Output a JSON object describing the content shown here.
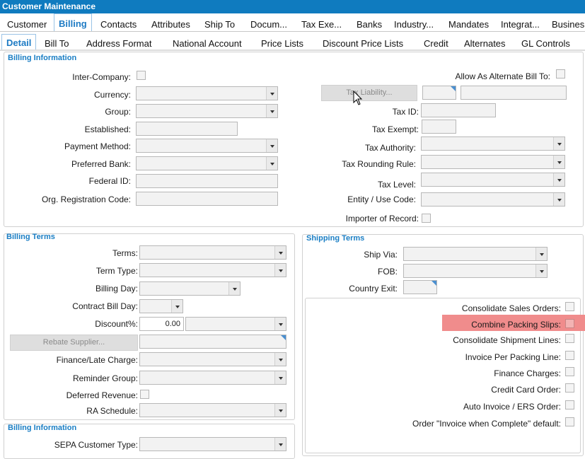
{
  "window": {
    "title": "Customer Maintenance"
  },
  "main_tabs": [
    "Customer",
    "Billing",
    "Contacts",
    "Attributes",
    "Ship To",
    "Docum...",
    "Tax Exe...",
    "Banks",
    "Industry...",
    "Mandates",
    "Integrat...",
    "Busines"
  ],
  "sub_tabs": [
    "Detail",
    "Bill To",
    "Address Format",
    "National Account",
    "Price Lists",
    "Discount Price Lists",
    "Credit",
    "Alternates",
    "GL Controls"
  ],
  "billing_info": {
    "title": "Billing Information",
    "inter_company": "Inter-Company:",
    "currency": "Currency:",
    "group": "Group:",
    "established": "Established:",
    "payment_method": "Payment Method:",
    "preferred_bank": "Preferred Bank:",
    "federal_id": "Federal ID:",
    "org_reg_code": "Org. Registration Code:",
    "allow_alt_bill_to": "Allow As Alternate Bill To:",
    "tax_liability_button": "Tax Liability...",
    "tax_id": "Tax ID:",
    "tax_exempt": "Tax Exempt:",
    "tax_authority": "Tax Authority:",
    "tax_rounding_rule": "Tax Rounding Rule:",
    "tax_level": "Tax Level:",
    "entity_use_code": "Entity / Use Code:",
    "importer_of_record": "Importer of Record:"
  },
  "billing_terms": {
    "title": "Billing Terms",
    "terms": "Terms:",
    "term_type": "Term Type:",
    "billing_day": "Billing Day:",
    "contract_bill_day": "Contract Bill Day:",
    "discount": "Discount%:",
    "discount_value": "0.00",
    "rebate_supplier_button": "Rebate Supplier...",
    "finance_late_charge": "Finance/Late Charge:",
    "reminder_group": "Reminder Group:",
    "deferred_revenue": "Deferred Revenue:",
    "ra_schedule": "RA Schedule:"
  },
  "shipping_terms": {
    "title": "Shipping Terms",
    "ship_via": "Ship Via:",
    "fob": "FOB:",
    "country_exit": "Country Exit:"
  },
  "options": {
    "consolidate_sales_orders": "Consolidate Sales Orders:",
    "combine_packing_slips": "Combine Packing Slips:",
    "consolidate_shipment_lines": "Consolidate Shipment Lines:",
    "invoice_per_packing_line": "Invoice Per Packing Line:",
    "finance_charges": "Finance Charges:",
    "credit_card_order": "Credit Card Order:",
    "auto_invoice_ers_order": "Auto Invoice / ERS Order:",
    "order_invoice_when_complete": "Order \"Invoice when Complete\" default:",
    "highlight_color": "#f08c8c"
  },
  "billing_info_2": {
    "title": "Billing Information",
    "sepa_customer_type": "SEPA Customer Type:"
  },
  "colors": {
    "title_bar": "#0f7bbf",
    "accent": "#1e7bc4"
  }
}
